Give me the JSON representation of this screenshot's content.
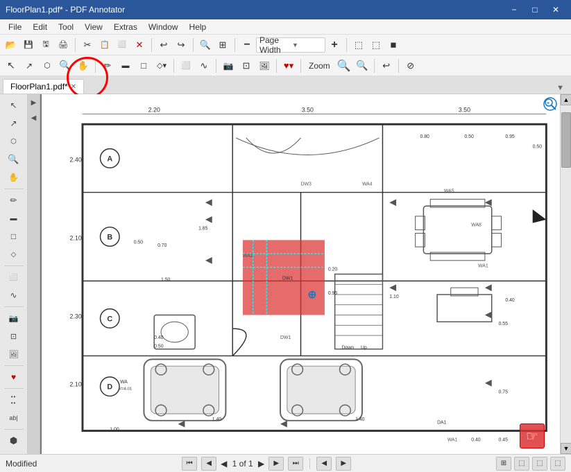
{
  "titleBar": {
    "title": "FloorPlan1.pdf* - PDF Annotator",
    "minimize": "−",
    "maximize": "□",
    "close": "✕"
  },
  "menuBar": {
    "items": [
      "File",
      "Edit",
      "Tool",
      "View",
      "Extras",
      "Window",
      "Help"
    ]
  },
  "toolbar1": {
    "buttons": [
      {
        "name": "open",
        "icon": "📂"
      },
      {
        "name": "save",
        "icon": "💾"
      },
      {
        "name": "save2",
        "icon": "🖫"
      },
      {
        "name": "print",
        "icon": "🖨"
      },
      {
        "name": "cut",
        "icon": "✂"
      },
      {
        "name": "copy",
        "icon": "📋"
      },
      {
        "name": "paste",
        "icon": "📌"
      },
      {
        "name": "delete",
        "icon": "✕"
      },
      {
        "name": "undo",
        "icon": "↩"
      },
      {
        "name": "redo",
        "icon": "↪"
      },
      {
        "name": "search",
        "icon": "🔍"
      },
      {
        "name": "grid",
        "icon": "⊞"
      },
      {
        "name": "minus",
        "icon": "−"
      },
      {
        "name": "page-width",
        "label": "Page Width"
      },
      {
        "name": "plus",
        "icon": "+"
      },
      {
        "name": "screen1",
        "icon": "⬚"
      },
      {
        "name": "screen2",
        "icon": "⬚"
      },
      {
        "name": "screen3",
        "icon": "◼"
      }
    ],
    "pageWidthDropdown": "Page Width"
  },
  "toolbar2": {
    "zoomLabel": "Zoom",
    "buttons": [
      {
        "name": "pointer",
        "icon": "↖"
      },
      {
        "name": "select",
        "icon": "↗"
      },
      {
        "name": "stamp",
        "icon": "⬡"
      },
      {
        "name": "zoom-in",
        "icon": "🔍+"
      },
      {
        "name": "hand",
        "icon": "✋"
      },
      {
        "name": "pen",
        "icon": "✏"
      },
      {
        "name": "highlight",
        "icon": "▬"
      },
      {
        "name": "rect",
        "icon": "□"
      },
      {
        "name": "shape",
        "icon": "◇"
      },
      {
        "name": "eraser",
        "icon": "⬜"
      },
      {
        "name": "lasso",
        "icon": "∿"
      },
      {
        "name": "camera",
        "icon": "📷"
      },
      {
        "name": "crop",
        "icon": "⊡"
      },
      {
        "name": "image",
        "icon": "🖼"
      },
      {
        "name": "heart",
        "icon": "♥"
      },
      {
        "name": "zoom-in2",
        "icon": "+"
      },
      {
        "name": "zoom-out",
        "icon": "−"
      },
      {
        "name": "undo2",
        "icon": "↩"
      },
      {
        "name": "eraser2",
        "icon": "⊘"
      }
    ]
  },
  "tabBar": {
    "tabs": [
      {
        "label": "FloorPlan1.pdf*",
        "active": true
      }
    ]
  },
  "statusBar": {
    "status": "Modified",
    "pageInfo": "1 of 1",
    "icons": [
      "⊞",
      "⬚",
      "⬚",
      "⬚"
    ]
  },
  "floorPlan": {
    "labels": {
      "sectionA": "A",
      "sectionB": "B",
      "sectionC": "C",
      "sectionD": "D",
      "down": "Down",
      "up": "Up"
    }
  }
}
